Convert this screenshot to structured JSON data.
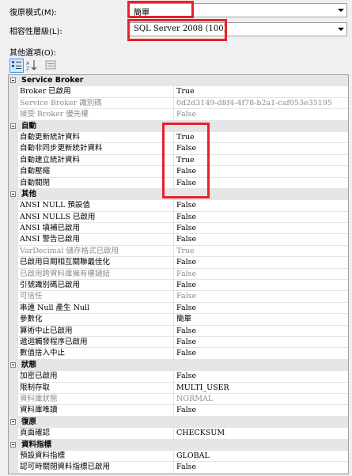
{
  "fields": {
    "recovery_model": {
      "label": "復原模式(M):",
      "value": "簡單"
    },
    "compat_level": {
      "label": "相容性層級(L):",
      "value": "SQL Server 2008 (100)"
    }
  },
  "other_options_label": "其他選項(O):",
  "toolbar": {
    "categorized": "categorized-icon",
    "alphabetical": "alphabetical-icon",
    "property_pages": "property-pages-icon"
  },
  "grid": [
    {
      "type": "cat",
      "name": "Service Broker"
    },
    {
      "type": "prop",
      "name": "Broker 已啟用",
      "value": "True"
    },
    {
      "type": "prop",
      "name": "Service Broker 識別碼",
      "value": "0d2d3149-d8f4-4f78-b2a1-caf053e35195",
      "grey": true
    },
    {
      "type": "prop",
      "name": "接受 Broker 優先權",
      "value": "False",
      "grey": true
    },
    {
      "type": "cat",
      "name": "自動"
    },
    {
      "type": "prop",
      "name": "自動更新統計資料",
      "value": "True"
    },
    {
      "type": "prop",
      "name": "自動非同步更新統計資料",
      "value": "False"
    },
    {
      "type": "prop",
      "name": "自動建立統計資料",
      "value": "True"
    },
    {
      "type": "prop",
      "name": "自動壓縮",
      "value": "False"
    },
    {
      "type": "prop",
      "name": "自動關閉",
      "value": "False"
    },
    {
      "type": "cat",
      "name": "其他"
    },
    {
      "type": "prop",
      "name": "ANSI NULL 預設值",
      "value": "False"
    },
    {
      "type": "prop",
      "name": "ANSI NULLS 已啟用",
      "value": "False"
    },
    {
      "type": "prop",
      "name": "ANSI 填補已啟用",
      "value": "False"
    },
    {
      "type": "prop",
      "name": "ANSI 警告已啟用",
      "value": "False"
    },
    {
      "type": "prop",
      "name": "VarDecimal 儲存格式已啟用",
      "value": "True",
      "grey": true
    },
    {
      "type": "prop",
      "name": "已啟用日期相互關聯最佳化",
      "value": "False"
    },
    {
      "type": "prop",
      "name": "已啟用跨資料庫擁有權鏈結",
      "value": "False",
      "grey": true
    },
    {
      "type": "prop",
      "name": "引號識別碼已啟用",
      "value": "False"
    },
    {
      "type": "prop",
      "name": "可信任",
      "value": "False",
      "grey": true
    },
    {
      "type": "prop",
      "name": "串連 Null 產生 Null",
      "value": "False"
    },
    {
      "type": "prop",
      "name": "參數化",
      "value": "簡單"
    },
    {
      "type": "prop",
      "name": "算術中止已啟用",
      "value": "False"
    },
    {
      "type": "prop",
      "name": "遞迴觸發程序已啟用",
      "value": "False"
    },
    {
      "type": "prop",
      "name": "數值捨入中止",
      "value": "False"
    },
    {
      "type": "cat",
      "name": "狀態"
    },
    {
      "type": "prop",
      "name": "加密已啟用",
      "value": "False"
    },
    {
      "type": "prop",
      "name": "限制存取",
      "value": "MULTI_USER"
    },
    {
      "type": "prop",
      "name": "資料庫狀態",
      "value": "NORMAL",
      "grey": true
    },
    {
      "type": "prop",
      "name": "資料庫唯讀",
      "value": "False"
    },
    {
      "type": "cat",
      "name": "復原"
    },
    {
      "type": "prop",
      "name": "頁面確認",
      "value": "CHECKSUM"
    },
    {
      "type": "cat",
      "name": "資料指標"
    },
    {
      "type": "prop",
      "name": "預設資料指標",
      "value": "GLOBAL"
    },
    {
      "type": "prop",
      "name": "認可時關閉資料指標已啟用",
      "value": "False"
    }
  ]
}
